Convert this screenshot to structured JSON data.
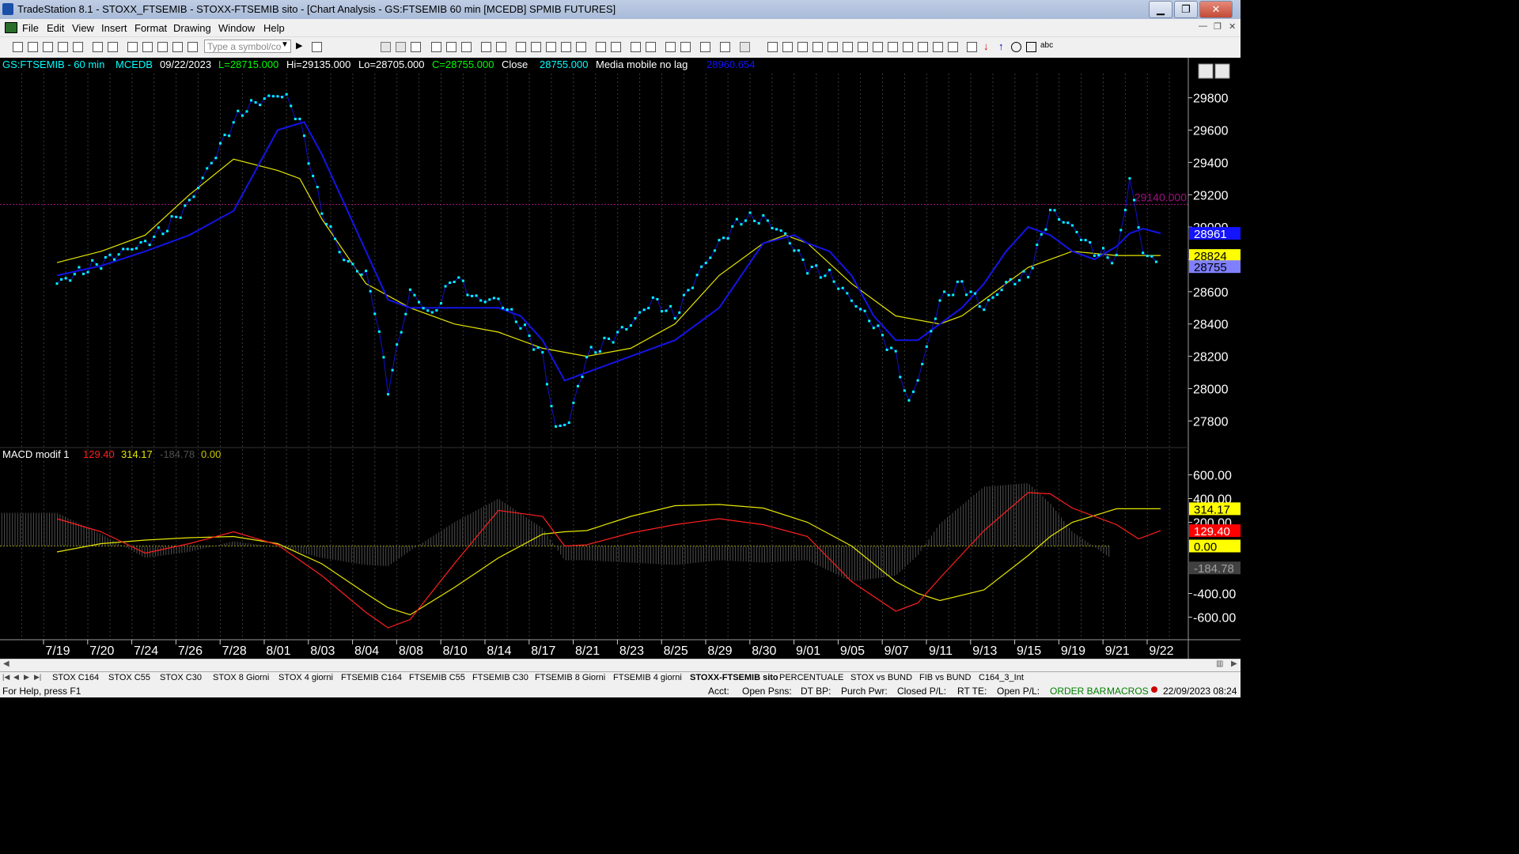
{
  "window": {
    "title": "TradeStation 8.1 - STOXX_FTSEMIB - STOXX-FTSEMIB sito - [Chart Analysis - GS:FTSEMIB  60 min  [MCEDB] SPMIB FUTURES]",
    "minimize": "▁",
    "restore": "❐",
    "close": "✕"
  },
  "menu": [
    "File",
    "Edit",
    "View",
    "Insert",
    "Format",
    "Drawing",
    "Window",
    "Help"
  ],
  "toolbar": {
    "symbol_placeholder": "Type a symbol/co"
  },
  "chart_data": {
    "type": "line",
    "header": {
      "symbol": "GS:FTSEMIB - 60 min",
      "exchange": "MCEDB",
      "date": "09/22/2023",
      "last": "L=28715.000",
      "high": "Hi=29135.000",
      "low": "Lo=28705.000",
      "close": "C=28755.000",
      "close_label": "Close",
      "close_value": "28755.000",
      "indicator": "Media mobile no lag",
      "indicator_value": "28960.654"
    },
    "price_axis": {
      "ticks": [
        29800,
        29600,
        29400,
        29200,
        29000,
        28800,
        28600,
        28400,
        28200,
        28000,
        27800
      ],
      "ylim": [
        27650,
        29950
      ],
      "hline_value": 29140,
      "hline_label": "29140.000",
      "badges": [
        {
          "label": "28961",
          "value": 28961,
          "bg": "#1414ff",
          "fg": "#ffffff"
        },
        {
          "label": "28824",
          "value": 28824,
          "bg": "#ffff00",
          "fg": "#000000"
        },
        {
          "label": "28755",
          "value": 28755,
          "bg": "#8080ff",
          "fg": "#000000"
        }
      ]
    },
    "dates": [
      "7/19",
      "7/20",
      "7/24",
      "7/26",
      "7/28",
      "8/01",
      "8/03",
      "8/04",
      "8/08",
      "8/10",
      "8/14",
      "8/17",
      "8/21",
      "8/23",
      "8/25",
      "8/29",
      "8/30",
      "9/01",
      "9/05",
      "9/07",
      "9/11",
      "9/13",
      "9/15",
      "9/19",
      "9/21",
      "9/22"
    ],
    "close_series": {
      "name": "Close",
      "color": "#00ffff",
      "x_index": [
        0,
        0.5,
        1,
        1.5,
        2,
        2.5,
        3,
        3.5,
        4,
        4.3,
        4.6,
        5,
        5.2,
        5.5,
        6,
        6.5,
        7,
        7.2,
        7.5,
        8,
        8.5,
        9,
        9.5,
        10,
        10.5,
        11,
        11.3,
        11.6,
        12,
        12.5,
        13,
        13.5,
        14,
        14.5,
        15,
        15.5,
        16,
        16.5,
        17,
        17.5,
        18,
        18.5,
        19,
        19.3,
        19.6,
        20,
        20.5,
        21,
        21.5,
        22,
        22.5,
        23,
        23.5,
        24,
        24.3,
        24.6,
        25
      ],
      "values": [
        28650,
        28720,
        28780,
        28850,
        28900,
        29000,
        29150,
        29400,
        29650,
        29740,
        29780,
        29820,
        29800,
        29650,
        29100,
        28800,
        28700,
        28500,
        28000,
        28600,
        28450,
        28700,
        28550,
        28550,
        28400,
        28200,
        27750,
        27800,
        28200,
        28300,
        28400,
        28550,
        28450,
        28700,
        28900,
        29050,
        29050,
        28950,
        28750,
        28700,
        28550,
        28400,
        28200,
        27900,
        28150,
        28550,
        28650,
        28500,
        28650,
        28700,
        29100,
        29000,
        28850,
        28800,
        29300,
        28850,
        28755
      ]
    },
    "ma_blue": {
      "color": "#1414e6",
      "x_index": [
        0,
        1,
        2,
        3,
        4,
        4.6,
        5,
        5.6,
        6,
        7,
        7.5,
        8,
        9,
        10,
        10.5,
        11,
        11.5,
        12,
        13,
        14,
        15,
        15.5,
        16,
        16.7,
        17,
        17.5,
        18,
        18.5,
        19,
        19.5,
        20,
        20.5,
        21,
        21.5,
        22,
        22.5,
        23,
        23.5,
        24,
        24.3,
        24.6,
        25
      ],
      "values": [
        28700,
        28760,
        28850,
        28950,
        29100,
        29400,
        29600,
        29650,
        29450,
        28850,
        28550,
        28500,
        28500,
        28500,
        28450,
        28300,
        28050,
        28100,
        28200,
        28300,
        28500,
        28700,
        28900,
        28950,
        28900,
        28850,
        28700,
        28450,
        28300,
        28300,
        28400,
        28500,
        28650,
        28850,
        29000,
        28950,
        28850,
        28800,
        28880,
        28961,
        28990,
        28961
      ]
    },
    "ma_yellow": {
      "color": "#e6e600",
      "x_index": [
        0,
        1,
        2,
        3,
        4,
        5,
        5.5,
        6,
        7,
        8,
        9,
        10,
        11,
        12,
        13,
        14,
        15,
        16,
        16.5,
        17,
        18,
        19,
        20,
        20.5,
        21,
        22,
        23,
        24,
        24.6,
        25
      ],
      "values": [
        28780,
        28850,
        28950,
        29200,
        29420,
        29350,
        29300,
        29050,
        28650,
        28500,
        28400,
        28350,
        28250,
        28200,
        28250,
        28400,
        28700,
        28900,
        28950,
        28900,
        28650,
        28450,
        28400,
        28450,
        28550,
        28750,
        28850,
        28824,
        28824,
        28824
      ]
    },
    "macd": {
      "title": "MACD modif 1",
      "macd_value": "129.40",
      "signal_value": "314.17",
      "hist_value": "-184.78",
      "zero_value": "0.00",
      "axis_ticks": [
        "600.00",
        "400.00",
        "200.00",
        "-400.00",
        "-600.00"
      ],
      "ylim": [
        -750,
        750
      ],
      "badges": [
        {
          "label": "314.17",
          "value": 314.17,
          "bg": "#ffff00",
          "fg": "#000000"
        },
        {
          "label": "129.40",
          "value": 129.4,
          "bg": "#ff0000",
          "fg": "#ffffff"
        },
        {
          "label": "0.00",
          "value": 0,
          "bg": "#ffff00",
          "fg": "#000000"
        },
        {
          "label": "-184.78",
          "value": -184.78,
          "bg": "#404040",
          "fg": "#a0a0a0"
        }
      ],
      "x_index": [
        0,
        1,
        2,
        3,
        4,
        5,
        6,
        7,
        7.5,
        8,
        9,
        10,
        11,
        11.5,
        12,
        13,
        14,
        15,
        16,
        17,
        18,
        19,
        19.5,
        20,
        21,
        22,
        22.5,
        23,
        24,
        24.5,
        25
      ],
      "macd_line": [
        230,
        120,
        -60,
        20,
        120,
        10,
        -250,
        -560,
        -690,
        -620,
        -150,
        300,
        250,
        0,
        10,
        110,
        180,
        230,
        180,
        80,
        -300,
        -550,
        -480,
        -270,
        130,
        450,
        440,
        320,
        180,
        60,
        129
      ],
      "signal_line": [
        -50,
        20,
        50,
        70,
        80,
        20,
        -150,
        -400,
        -520,
        -580,
        -350,
        -100,
        100,
        120,
        130,
        250,
        340,
        350,
        320,
        200,
        0,
        -300,
        -400,
        -460,
        -370,
        -80,
        80,
        200,
        314,
        314,
        314
      ],
      "histogram": [
        280,
        100,
        -100,
        -50,
        40,
        -10,
        -100,
        -160,
        -170,
        -40,
        200,
        400,
        150,
        -120,
        -120,
        -140,
        -160,
        -120,
        -140,
        -120,
        -300,
        -250,
        -80,
        190,
        500,
        530,
        360,
        120,
        -134,
        -180,
        -184.78
      ],
      "colors": {
        "macd": "#ff2020",
        "signal": "#e6e600",
        "hist": "#505050"
      }
    }
  },
  "tabs": [
    "STOX C164",
    "STOX C55",
    "STOX  C30",
    "STOX  8 Giorni",
    "STOX 4 giorni",
    "FTSEMIB C164",
    "FTSEMIB C55",
    "FTSEMIB C30",
    "FTSEMIB  8 Giorni",
    "FTSEMIB  4 giorni",
    "STOXX-FTSEMIB sito",
    "PERCENTUALE",
    "STOX vs BUND",
    "FIB vs BUND",
    "C164_3_Int"
  ],
  "status": {
    "help": "For Help, press F1",
    "acct": "Acct:",
    "open_psns": "Open Psns:",
    "dt_bp": "DT BP:",
    "purch_pwr": "Purch Pwr:",
    "closed_pl": "Closed P/L:",
    "rt_te": "RT TE:",
    "open_pl": "Open P/L:",
    "order_bar": "ORDER BAR",
    "macros": "MACROS",
    "datetime": "22/09/2023 08:24"
  }
}
